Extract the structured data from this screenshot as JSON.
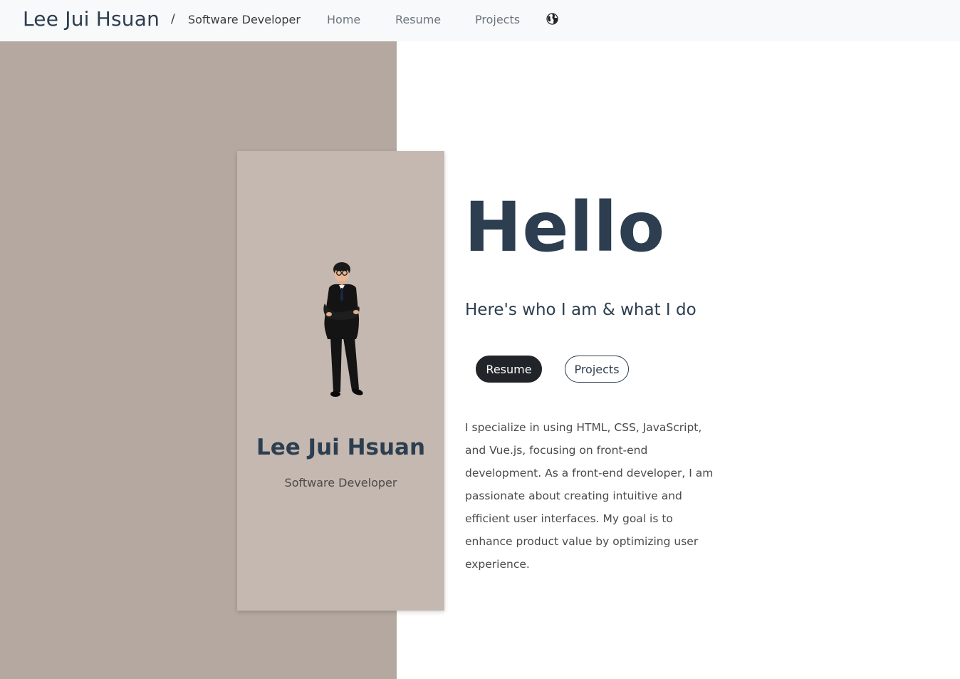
{
  "navbar": {
    "brand_name": "Lee Jui Hsuan",
    "separator": "/",
    "brand_role": "Software Developer",
    "links": [
      {
        "label": "Home"
      },
      {
        "label": "Resume"
      },
      {
        "label": "Projects"
      }
    ],
    "language_icon": "globe-icon"
  },
  "profile": {
    "name": "Lee Jui Hsuan",
    "role": "Software Developer",
    "avatar_icon": "person-photo"
  },
  "hero": {
    "heading": "Hello",
    "subtitle": "Here's who I am & what I do",
    "buttons": {
      "resume": "Resume",
      "projects": "Projects"
    },
    "bio": "I specialize in using HTML, CSS, JavaScript, and Vue.js, focusing on front-end development. As a front-end developer, I am passionate about creating intuitive and efficient user interfaces. My goal is to enhance product value by optimizing user experience."
  },
  "colors": {
    "left_bg": "#b4a8a0",
    "card_bg": "#c4b8b0",
    "primary_text": "#2c3e50",
    "dark_button": "#212529",
    "navbar_bg": "#f8f9fa"
  }
}
